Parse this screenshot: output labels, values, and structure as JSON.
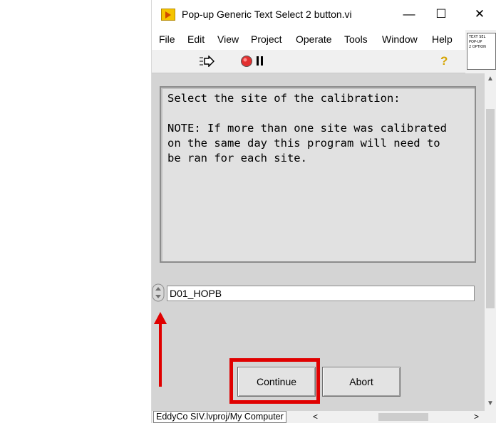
{
  "window": {
    "title": "Pop-up Generic Text Select 2 button.vi",
    "minimize_glyph": "—",
    "maximize_glyph": "☐",
    "close_glyph": "✕"
  },
  "menu": {
    "items": [
      "File",
      "Edit",
      "View",
      "Project",
      "Operate",
      "Tools",
      "Window",
      "Help"
    ]
  },
  "toolbar": {
    "icons": [
      "run-arrow-icon",
      "abort-stop-icon",
      "pause-icon",
      "context-help-icon"
    ],
    "help_glyph": "?"
  },
  "connector_pane": {
    "lines": [
      "TEXT SEL",
      "POP-UP",
      "2 OPTION"
    ]
  },
  "panel": {
    "message": "Select the site of the calibration:\n\nNOTE: If more than one site was calibrated\non the same day this program will need to\nbe ran for each site.",
    "ring_value": "D01_HOPB",
    "continue_label": "Continue",
    "abort_label": "Abort"
  },
  "status": {
    "project_path": "EddyCo SIV.lvproj/My Computer",
    "left_arrow": "<",
    "right_arrow": ">"
  },
  "colors": {
    "annotation_red": "#e00000",
    "panel_bg": "#d4d4d4",
    "vi_icon_yellow": "#f5c400"
  }
}
